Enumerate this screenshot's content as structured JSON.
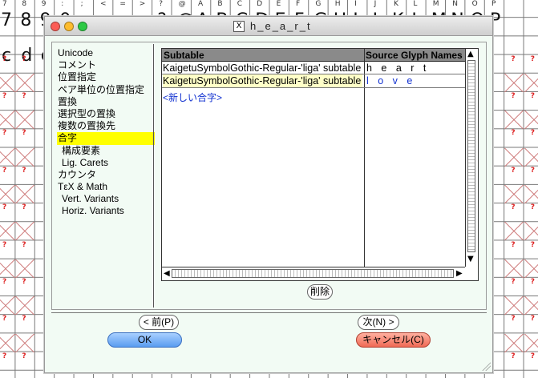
{
  "window": {
    "title": "h_e_a_r_t"
  },
  "sidebar": {
    "items": [
      {
        "label": "Unicode"
      },
      {
        "label": "コメント"
      },
      {
        "label": "位置指定"
      },
      {
        "label": "ペア単位の位置指定"
      },
      {
        "label": "置換"
      },
      {
        "label": "選択型の置換"
      },
      {
        "label": "複数の置換先"
      },
      {
        "label": "合字"
      },
      {
        "label": "構成要素"
      },
      {
        "label": "Lig. Carets"
      },
      {
        "label": "カウンタ"
      },
      {
        "label": "TεX & Math"
      },
      {
        "label": "Vert. Variants"
      },
      {
        "label": "Horiz. Variants"
      }
    ],
    "selected": "合字",
    "selected_color": "#ffff00"
  },
  "table": {
    "headers": {
      "subtable": "Subtable",
      "source": "Source Glyph Names"
    },
    "rows": [
      {
        "subtable": "KaigetuSymbolGothic-Regular-'liga' subtable",
        "source": "h e a r t"
      },
      {
        "subtable": "KaigetuSymbolGothic-Regular-'liga' subtable",
        "source": "l o v e"
      }
    ],
    "new_entry": "<新しい合字>",
    "highlight_color": "#ffffc8"
  },
  "buttons": {
    "delete": "削除",
    "prev": "< 前(P)",
    "next": "次(N) >",
    "ok": "OK",
    "cancel": "キャンセル(C)"
  },
  "background": {
    "top_chars": [
      "7",
      "8",
      "9",
      ":",
      ";",
      "<",
      "=",
      ">",
      "?",
      "@",
      "A",
      "B",
      "C",
      "D",
      "E",
      "F",
      "G",
      "H",
      "I",
      "J",
      "K",
      "L",
      "M",
      "N",
      "O",
      "P"
    ],
    "row2_chars": [
      "7",
      "8",
      "9",
      "0",
      ";",
      "<",
      "=",
      ">",
      "?",
      "@",
      "A",
      "B",
      "C",
      "D",
      "E",
      "F",
      "G",
      "H",
      "I",
      "J",
      "K",
      "L",
      "M",
      "N",
      "O",
      "P"
    ],
    "row3_chars": [
      "c",
      "d",
      "e"
    ]
  }
}
